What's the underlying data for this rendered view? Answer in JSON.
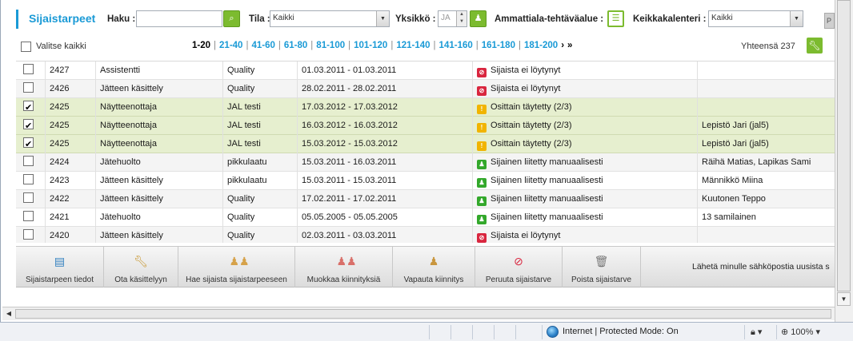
{
  "header": {
    "title": "Sijaistarpeet",
    "haku_label": "Haku :",
    "haku_value": "",
    "tila_label": "Tila :",
    "tila_value": "Kaikki",
    "yksikko_label": "Yksikkö :",
    "yksikko_value": "JA",
    "ammattiala_label": "Ammattiala-tehtäväalue :",
    "keikka_label": "Keikkakalenteri :",
    "keikka_value": "Kaikki",
    "cut_button": "P"
  },
  "pager": {
    "select_all": "Valitse kaikki",
    "pages": [
      "1-20",
      "21-40",
      "41-60",
      "61-80",
      "81-100",
      "101-120",
      "121-140",
      "141-160",
      "161-180",
      "181-200"
    ],
    "current": "1-20",
    "next": "›",
    "last": "»",
    "total": "Yhteensä 237"
  },
  "rows": [
    {
      "checked": false,
      "id": "2427",
      "name": "Assistentti",
      "unit": "Quality",
      "dates": "01.03.2011 - 01.03.2011",
      "status": "Sijaista ei löytynyt",
      "status_color": "red",
      "person": ""
    },
    {
      "checked": false,
      "id": "2426",
      "name": "Jätteen käsittely",
      "unit": "Quality",
      "dates": "28.02.2011 - 28.02.2011",
      "status": "Sijaista ei löytynyt",
      "status_color": "red",
      "person": ""
    },
    {
      "checked": true,
      "id": "2425",
      "name": "Näytteenottaja",
      "unit": "JAL testi",
      "dates": "17.03.2012 - 17.03.2012",
      "status": "Osittain täytetty (2/3)",
      "status_color": "yellow",
      "person": ""
    },
    {
      "checked": true,
      "id": "2425",
      "name": "Näytteenottaja",
      "unit": "JAL testi",
      "dates": "16.03.2012 - 16.03.2012",
      "status": "Osittain täytetty (2/3)",
      "status_color": "yellow",
      "person": "Lepistö Jari (jal5)"
    },
    {
      "checked": true,
      "id": "2425",
      "name": "Näytteenottaja",
      "unit": "JAL testi",
      "dates": "15.03.2012 - 15.03.2012",
      "status": "Osittain täytetty (2/3)",
      "status_color": "yellow",
      "person": "Lepistö Jari (jal5)"
    },
    {
      "checked": false,
      "id": "2424",
      "name": "Jätehuolto",
      "unit": "pikkulaatu",
      "dates": "15.03.2011 - 16.03.2011",
      "status": "Sijainen liitetty manuaalisesti",
      "status_color": "green",
      "person": "Räihä Matias, Lapikas Sami"
    },
    {
      "checked": false,
      "id": "2423",
      "name": "Jätteen käsittely",
      "unit": "pikkulaatu",
      "dates": "15.03.2011 - 15.03.2011",
      "status": "Sijainen liitetty manuaalisesti",
      "status_color": "green",
      "person": "Männikkö Miina"
    },
    {
      "checked": false,
      "id": "2422",
      "name": "Jätteen käsittely",
      "unit": "Quality",
      "dates": "17.02.2011 - 17.02.2011",
      "status": "Sijainen liitetty manuaalisesti",
      "status_color": "green",
      "person": "Kuutonen Teppo"
    },
    {
      "checked": false,
      "id": "2421",
      "name": "Jätehuolto",
      "unit": "Quality",
      "dates": "05.05.2005 - 05.05.2005",
      "status": "Sijainen liitetty manuaalisesti",
      "status_color": "green",
      "person": "13 samilainen"
    },
    {
      "checked": false,
      "id": "2420",
      "name": "Jätteen käsittely",
      "unit": "Quality",
      "dates": "02.03.2011 - 03.03.2011",
      "status": "Sijaista ei löytynyt",
      "status_color": "red",
      "person": ""
    }
  ],
  "toolbar": {
    "buttons": [
      {
        "label": "Sijaistarpeen tiedot",
        "icon": "document-icon"
      },
      {
        "label": "Ota käsittelyyn",
        "icon": "wrench-icon"
      },
      {
        "label": "Hae sijaista sijaistarpeeseen",
        "icon": "people-search-icon"
      },
      {
        "label": "Muokkaa kiinnityksiä",
        "icon": "people-edit-icon"
      },
      {
        "label": "Vapauta kiinnitys",
        "icon": "person-remove-icon"
      },
      {
        "label": "Peruuta sijaistarve",
        "icon": "cancel-icon"
      },
      {
        "label": "Poista sijaistarve",
        "icon": "trash-icon"
      }
    ],
    "email_label": "Lähetä minulle sähköpostia uusista s"
  },
  "statusbar": {
    "zone": "Internet | Protected Mode: On",
    "zoom": "100%"
  },
  "colors": {
    "accent": "#1a9ad6",
    "green": "#7cbb2f",
    "selected_row": "#e6efcf"
  }
}
